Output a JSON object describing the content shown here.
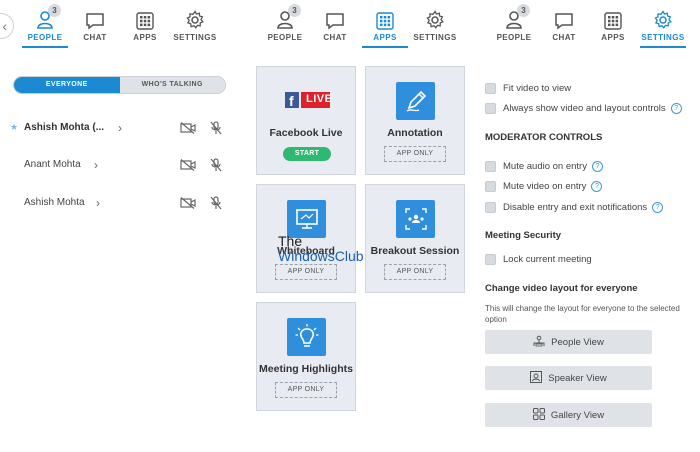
{
  "people_panel": {
    "tabs": [
      {
        "label": "PEOPLE",
        "badge": "3",
        "active": true
      },
      {
        "label": "CHAT"
      },
      {
        "label": "APPS"
      },
      {
        "label": "SETTINGS"
      }
    ],
    "segments": {
      "everyone": "EVERYONE",
      "whos_talking": "WHO'S TALKING"
    },
    "participants": [
      {
        "name": "Ashish Mohta (...",
        "host": true
      },
      {
        "name": "Anant Mohta"
      },
      {
        "name": "Ashish Mohta"
      }
    ]
  },
  "apps_panel": {
    "tabs": [
      {
        "label": "PEOPLE",
        "badge": "3"
      },
      {
        "label": "CHAT"
      },
      {
        "label": "APPS",
        "active": true
      },
      {
        "label": "SETTINGS"
      }
    ],
    "apps": [
      {
        "title": "Facebook Live",
        "button": "START",
        "icon": "facebook-live-icon",
        "live_text": "LIVE"
      },
      {
        "title": "Annotation",
        "button": "APP ONLY",
        "icon": "pen-icon"
      },
      {
        "title": "Whiteboard",
        "button": "APP ONLY",
        "icon": "whiteboard-icon"
      },
      {
        "title": "Breakout Session",
        "button": "APP ONLY",
        "icon": "breakout-icon"
      },
      {
        "title": "Meeting Highlights",
        "button": "APP ONLY",
        "icon": "lightbulb-icon"
      }
    ],
    "watermark": {
      "line1": "The",
      "line2": "WindowsClub"
    }
  },
  "settings_panel": {
    "tabs": [
      {
        "label": "PEOPLE",
        "badge": "3"
      },
      {
        "label": "CHAT"
      },
      {
        "label": "APPS"
      },
      {
        "label": "SETTINGS",
        "active": true
      }
    ],
    "video_options": [
      {
        "label": "Fit video to view"
      },
      {
        "label": "Always show video and layout controls",
        "help": true
      }
    ],
    "moderator_title": "MODERATOR CONTROLS",
    "moderator_options": [
      {
        "label": "Mute audio on entry",
        "help": true
      },
      {
        "label": "Mute video on entry",
        "help": true
      },
      {
        "label": "Disable entry and exit notifications",
        "help": true
      }
    ],
    "security_title": "Meeting Security",
    "security_options": [
      {
        "label": "Lock current meeting"
      }
    ],
    "layout_title": "Change video layout for everyone",
    "layout_note": "This will change the layout for everyone to the selected option",
    "layout_buttons": [
      {
        "label": "People View",
        "icon": "people-view-icon"
      },
      {
        "label": "Speaker View",
        "icon": "speaker-view-icon"
      },
      {
        "label": "Gallery View",
        "icon": "gallery-view-icon"
      }
    ],
    "help_glyph": "?"
  },
  "colors": {
    "accent": "#1b8ad3",
    "start": "#2eb872",
    "facebook": "#3b5998",
    "live": "#e0202a"
  }
}
